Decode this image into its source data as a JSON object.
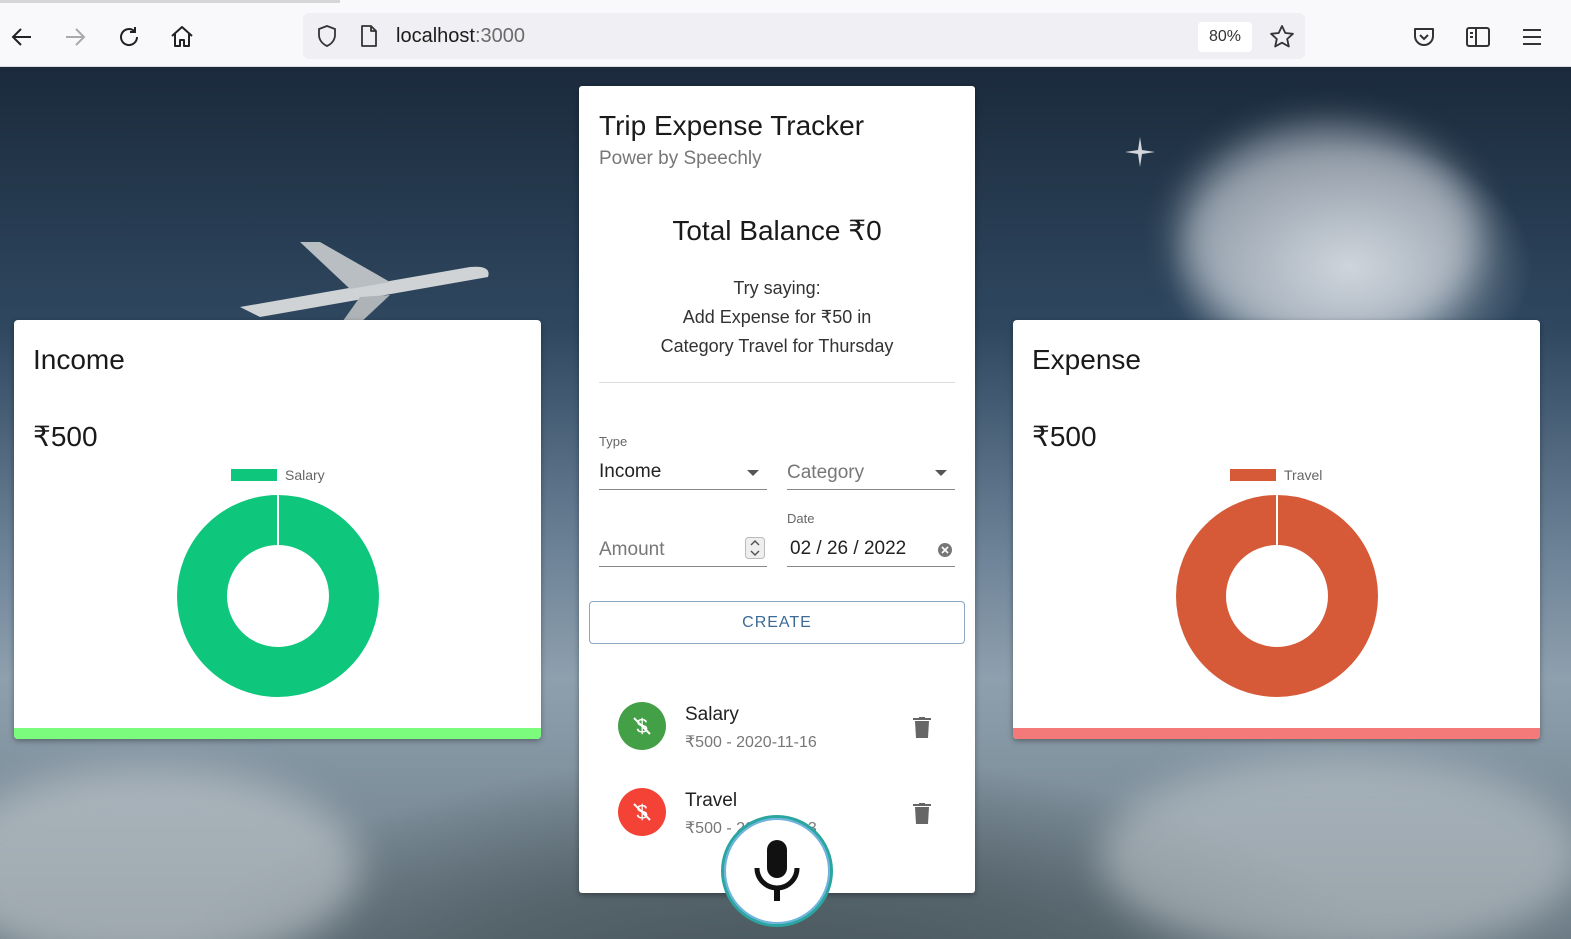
{
  "browser": {
    "url_host": "localhost",
    "url_port": ":3000",
    "zoom": "80%",
    "icons": [
      "back-icon",
      "forward-icon",
      "reload-icon",
      "home-icon",
      "shield-icon",
      "page-icon",
      "star-icon",
      "pocket-icon",
      "sidebar-icon",
      "menu-icon"
    ]
  },
  "income_card": {
    "title": "Income",
    "amount": "₹500",
    "legend": "Salary",
    "color": "#0ec67c",
    "bar_color": "#7cfc7c"
  },
  "expense_card": {
    "title": "Expense",
    "amount": "₹500",
    "legend": "Travel",
    "color": "#d65a37",
    "bar_color": "#f47a7a"
  },
  "main": {
    "title": "Trip Expense Tracker",
    "subtitle": "Power by Speechly",
    "balance": "Total Balance ₹0",
    "hint_line1": "Try saying:",
    "hint_line2": "Add Expense for ₹50 in",
    "hint_line3": "Category Travel for Thursday",
    "form": {
      "type_label": "Type",
      "type_value": "Income",
      "category_placeholder": "Category",
      "amount_placeholder": "Amount",
      "date_label": "Date",
      "date_value": "02 / 26 / 2022",
      "create_label": "CREATE"
    },
    "transactions": [
      {
        "title": "Salary",
        "subtitle": "₹500 - 2020-11-16",
        "color": "#43a047"
      },
      {
        "title": "Travel",
        "subtitle": "₹500 - 2020-11-13",
        "color": "#f44336"
      }
    ]
  }
}
